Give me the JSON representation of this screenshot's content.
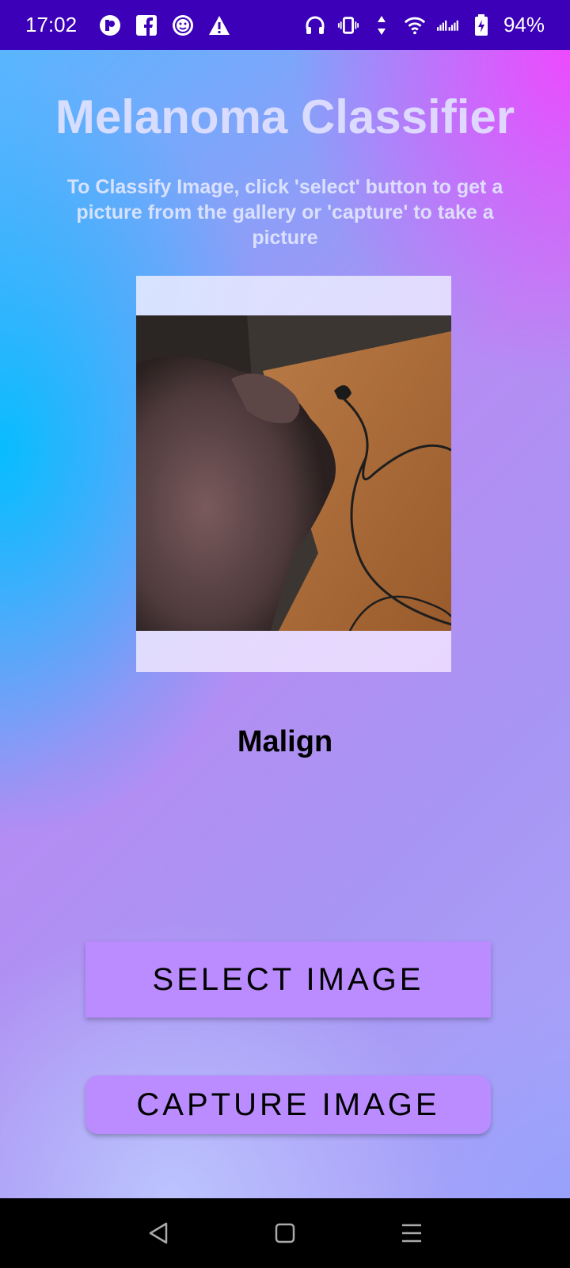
{
  "status_bar": {
    "time": "17:02",
    "battery": "94%",
    "left_icons": [
      "app-p-icon",
      "facebook-icon",
      "face-app-icon",
      "warning-icon"
    ],
    "right_icons": [
      "headphones-icon",
      "vibrate-icon",
      "data-arrows-icon",
      "wifi-icon",
      "signal-icon",
      "battery-charging-icon"
    ]
  },
  "app": {
    "title": "Melanoma Classifier",
    "instructions": "To Classify Image, click 'select' button to get a picture from the gallery or 'capture' to take a picture",
    "result": "Malign",
    "select_button": "SELECT IMAGE",
    "capture_button": "CAPTURE IMAGE"
  },
  "nav_bar": {
    "icons": [
      "back-icon",
      "home-icon",
      "menu-icon"
    ]
  },
  "colors": {
    "status_bar": "#3b00b8",
    "button": "#bb8cff",
    "nav_bar": "#000000"
  }
}
